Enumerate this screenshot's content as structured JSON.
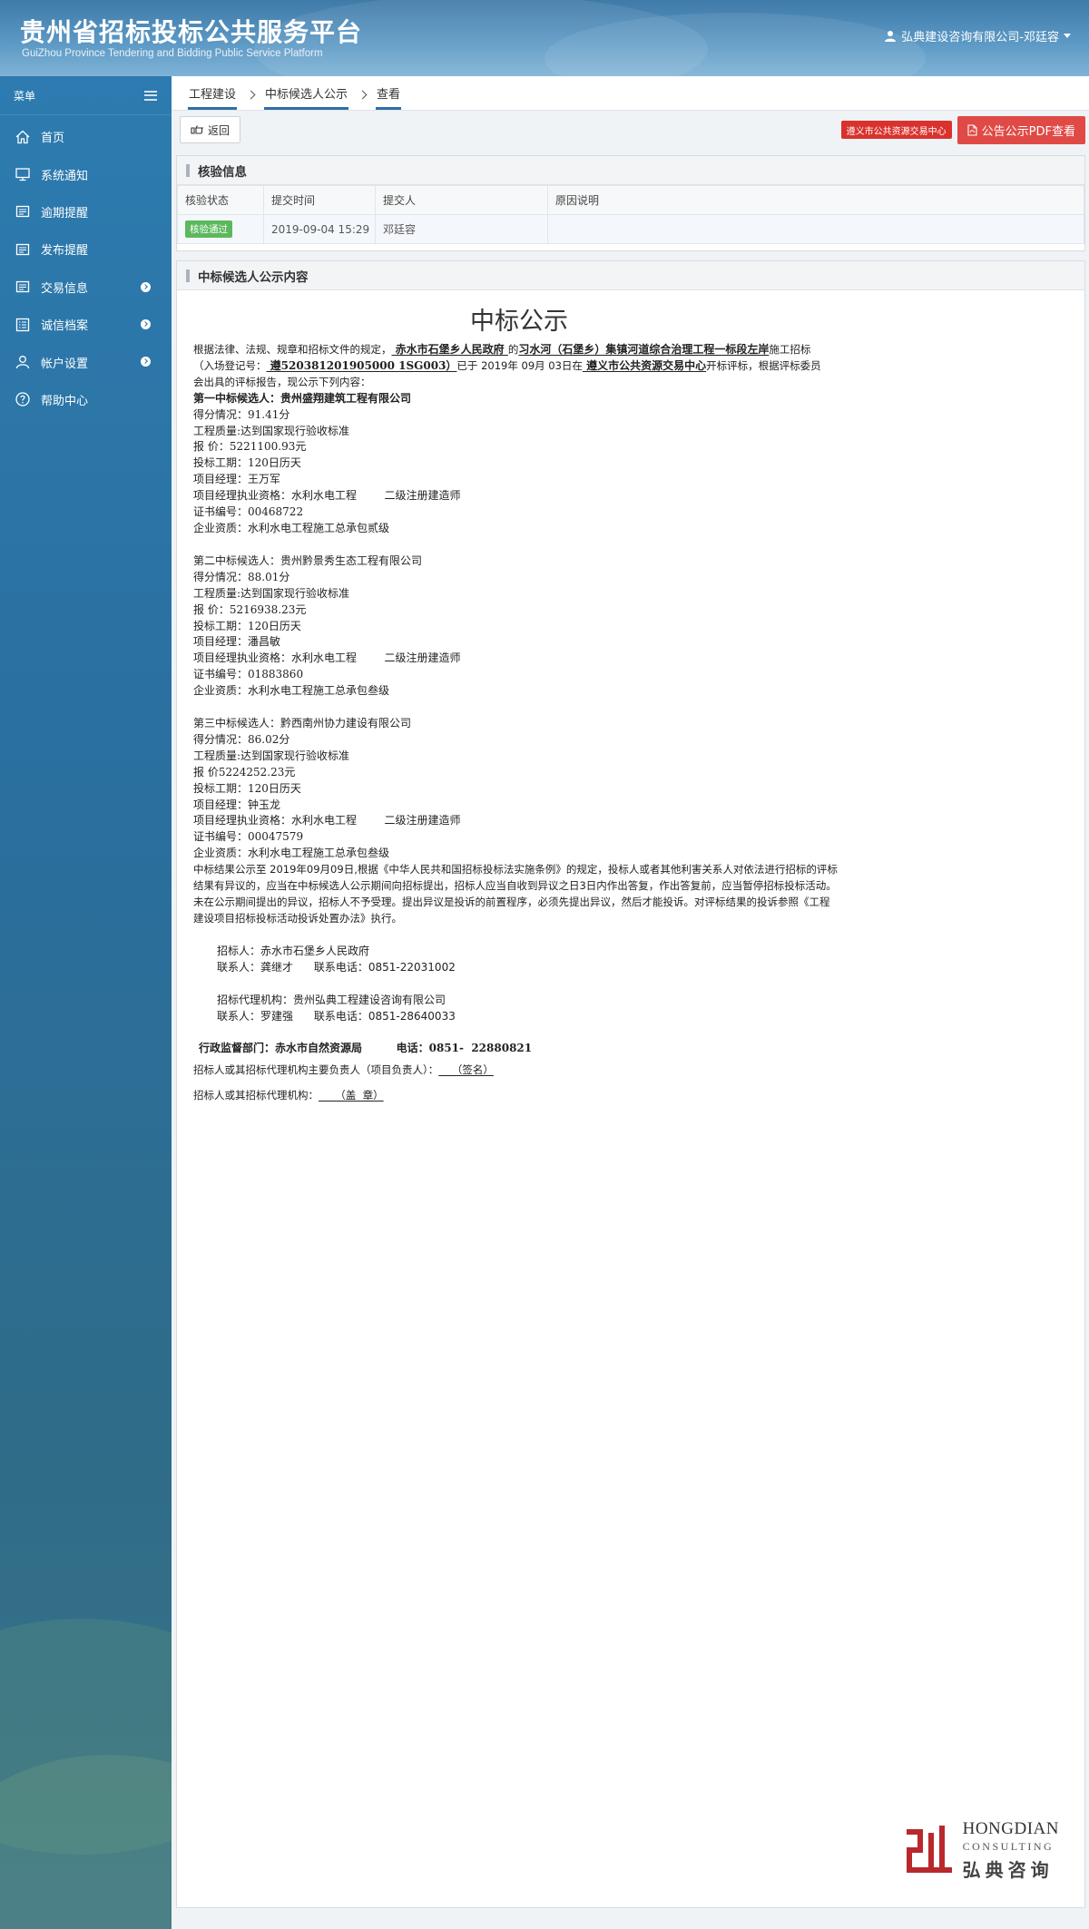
{
  "header": {
    "title_cn": "贵州省招标投标公共服务平台",
    "title_en": "GuiZhou Province Tendering and Bidding Public Service Platform",
    "user": "弘典建设咨询有限公司-邓廷容"
  },
  "sidebar": {
    "menu_label": "菜单",
    "items": [
      {
        "label": "首页",
        "icon": "home-icon"
      },
      {
        "label": "系统通知",
        "icon": "monitor-icon"
      },
      {
        "label": "逾期提醒",
        "icon": "folder-icon"
      },
      {
        "label": "发布提醒",
        "icon": "folder-icon"
      },
      {
        "label": "交易信息",
        "icon": "folder-icon"
      },
      {
        "label": "诚信档案",
        "icon": "list-icon"
      },
      {
        "label": "帐户设置",
        "icon": "user-icon"
      },
      {
        "label": "帮助中心",
        "icon": "help-icon"
      }
    ]
  },
  "breadcrumb": [
    "工程建设",
    "中标候选人公示",
    "查看"
  ],
  "toolbar": {
    "back_label": "返回",
    "center_label": "遵义市公共资源交易中心",
    "pdf_label": "公告公示PDF查看"
  },
  "verify": {
    "title": "核验信息",
    "headers": [
      "核验状态",
      "提交时间",
      "提交人",
      "原因说明"
    ],
    "status": "核验通过",
    "time": "2019-09-04 15:29",
    "submitter": "邓廷容",
    "reason": ""
  },
  "content": {
    "section_title": "中标候选人公示内容",
    "doc_title": "中标公示",
    "intro": {
      "p1": "根据法律、法规、规章和招标文件的规定，",
      "tenderer": "  赤水市石堡乡人民政府    ",
      "p2": "的",
      "project": "习水河（石堡乡）集镇河道综合治理工程一标段左岸",
      "p3": "施工招标（入场登记号：",
      "reg_no": "  遵520381201905000 1SG003）",
      "p4": "已于 2019年 09月 03日在",
      "place": "  遵义市公共资源交易中心",
      "p5": "开标评标，根据评标委员会出具的评标报告，现公示下列内容："
    },
    "candidates": [
      {
        "name": "第一中标候选人：贵州盛翔建筑工程有限公司",
        "score": "得分情况：91.41分",
        "quality": "工程质量:达到国家现行验收标准",
        "price": "报  价：5221100.93元",
        "period": "投标工期：120日历天",
        "manager": "项目经理：王万军",
        "qualification": "项目经理执业资格：水利水电工程        二级注册建造师",
        "cert": "证书编号：00468722",
        "company_qual": "企业资质：水利水电工程施工总承包贰级"
      },
      {
        "name": "第二中标候选人：贵州黔景秀生态工程有限公司",
        "score": "得分情况：88.01分",
        "quality": "工程质量:达到国家现行验收标准",
        "price": "报  价：5216938.23元",
        "period": "投标工期：120日历天",
        "manager": "项目经理：潘昌敏",
        "qualification": "项目经理执业资格：水利水电工程        二级注册建造师",
        "cert": "证书编号：01883860",
        "company_qual": "企业资质：水利水电工程施工总承包叁级"
      },
      {
        "name": "第三中标候选人：黔西南州协力建设有限公司",
        "score": "得分情况：86.02分",
        "quality": "工程质量:达到国家现行验收标准",
        "price": "报  价5224252.23元",
        "period": "投标工期：120日历天",
        "manager": "项目经理：钟玉龙",
        "qualification": "项目经理执业资格：水利水电工程        二级注册建造师",
        "cert": "证书编号：00047579",
        "company_qual": "企业资质：水利水电工程施工总承包叁级"
      }
    ],
    "notice": "中标结果公示至  2019年09月09日,根据《中华人民共和国招标投标法实施条例》的规定，投标人或者其他利害关系人对依法进行招标的评标结果有异议的，应当在中标候选人公示期间向招标提出，招标人应当自收到异议之日3日内作出答复，作出答复前，应当暂停招标投标活动。未在公示期间提出的异议，招标人不予受理。提出异议是投诉的前置程序，必须先提出异议，然后才能投诉。对评标结果的投诉参照《工程建设项目招标投标活动投诉处置办法》执行。",
    "tenderer_line": "招标人：赤水市石堡乡人民政府",
    "tenderer_contact": "联系人：龚继才      联系电话：0851-22031002",
    "agency_line": "招标代理机构：贵州弘典工程建设咨询有限公司",
    "agency_contact": "联系人：罗建强      联系电话：0851-28640033",
    "supervisor": "行政监督部门：赤水市自然资源局         电话：0851-  22880821",
    "sign1_label": "招标人或其招标代理机构主要负责人（项目负责人）：",
    "sign1_value": "    （签名）",
    "sign2_label": "招标人或其招标代理机构：",
    "sign2_value": "     （盖  章）"
  },
  "logo": {
    "en1": "HONGDIAN",
    "en2": "CONSULTING",
    "cn": "弘典咨询"
  },
  "colors": {
    "header": "#3f7aa8",
    "sidebar": "#2a6f9e",
    "accent_red": "#e04a46",
    "badge_green": "#5cb85c",
    "logo_red": "#b8282d"
  }
}
